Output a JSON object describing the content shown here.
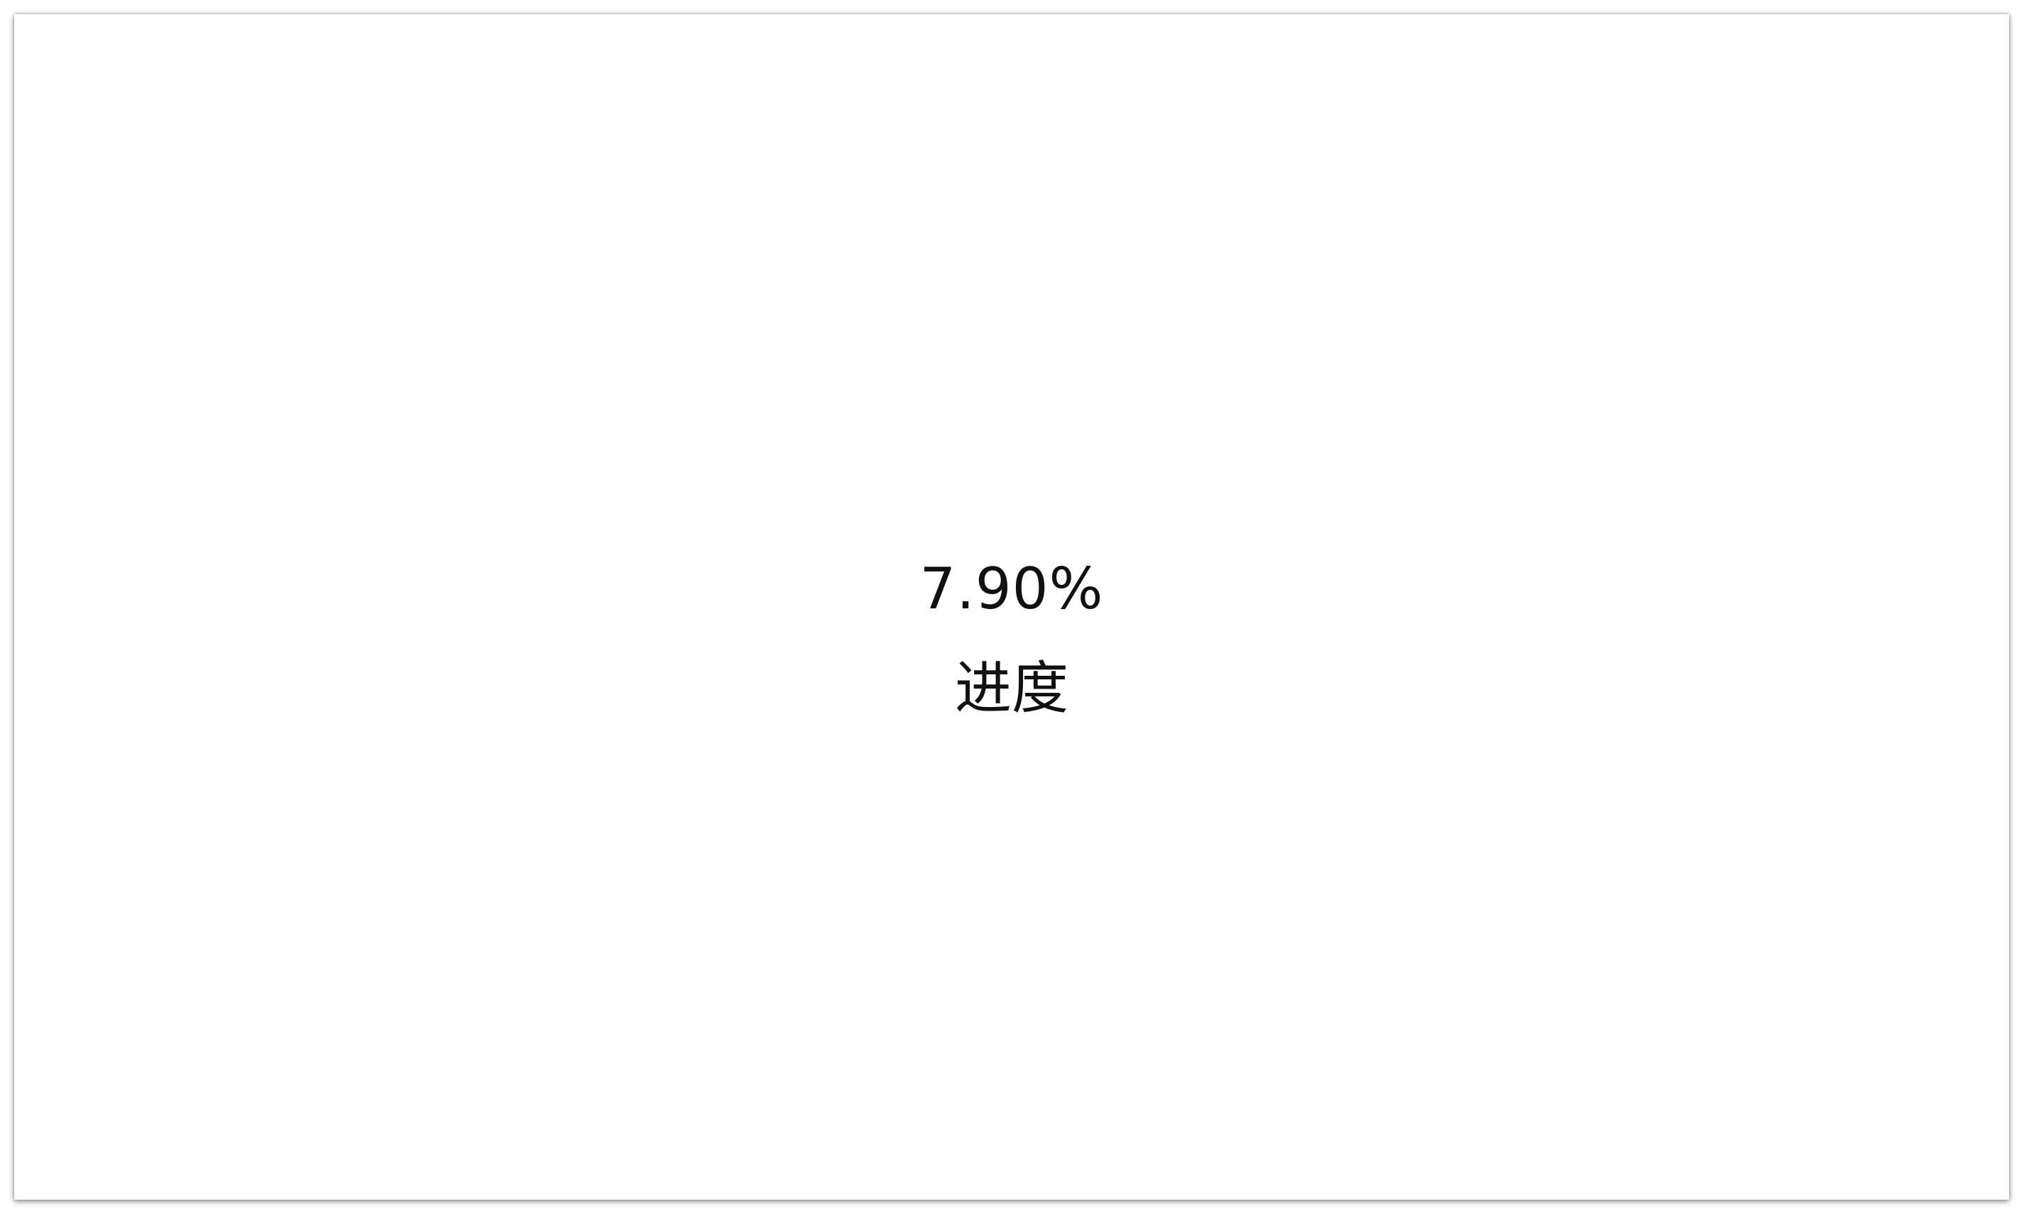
{
  "progress": {
    "value_text": "7.90%",
    "label": "进度",
    "value_percent": 7.9
  }
}
